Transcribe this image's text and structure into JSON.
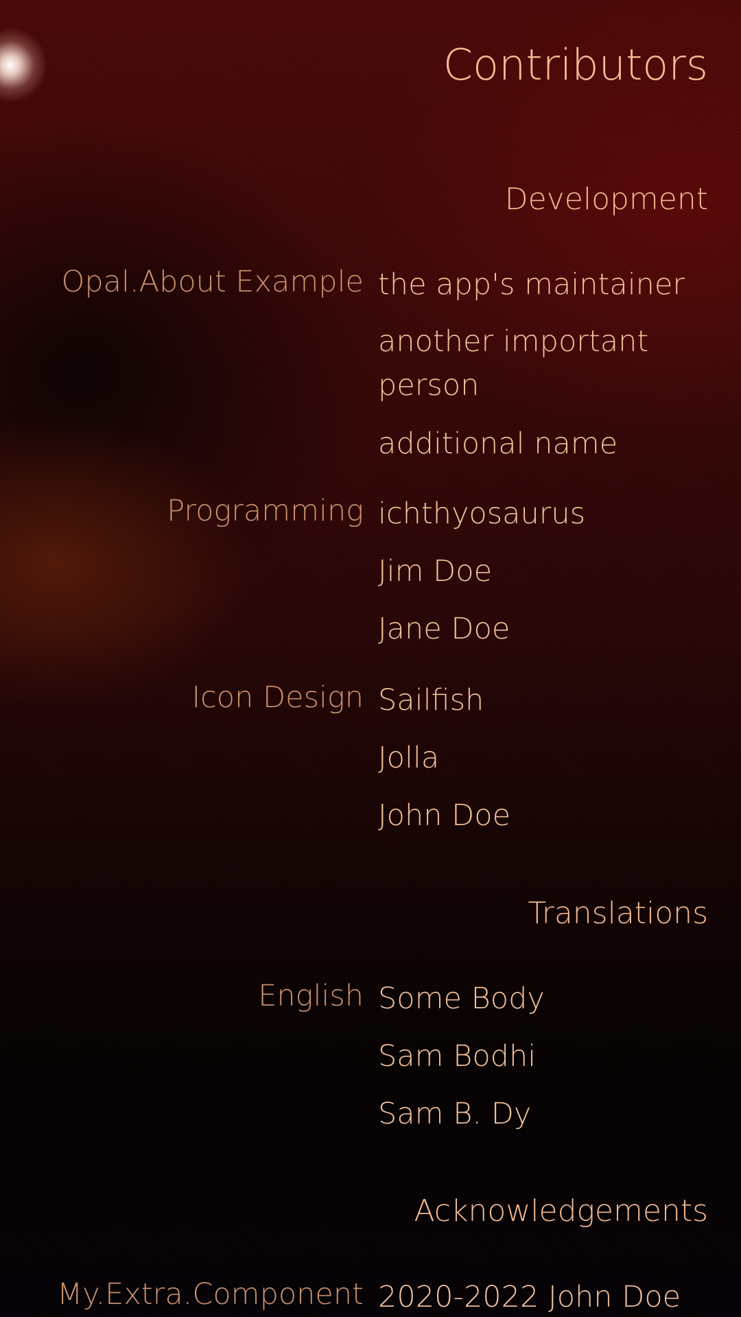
{
  "page": {
    "title": "Contributors"
  },
  "sections": [
    {
      "header": "Development",
      "groups": [
        {
          "label": "Opal.About Example",
          "names": [
            "the app's maintainer",
            "another important person",
            "additional name"
          ]
        },
        {
          "label": "Programming",
          "names": [
            "ichthyosaurus",
            "Jim Doe",
            "Jane Doe"
          ]
        },
        {
          "label": "Icon Design",
          "names": [
            "Sailfish",
            "Jolla",
            "John Doe"
          ]
        }
      ]
    },
    {
      "header": "Translations",
      "groups": [
        {
          "label": "English",
          "names": [
            "Some Body",
            "Sam Bodhi",
            "Sam B. Dy"
          ]
        }
      ]
    },
    {
      "header": "Acknowledgements",
      "groups": [
        {
          "label": "My.Extra.Component",
          "names": [
            "2020-2022 John Doe"
          ]
        }
      ]
    }
  ],
  "colors": {
    "title": "#f3bb94",
    "label": "#c8906d",
    "value": "#f0c09b",
    "background_top": "#4a0808",
    "background_bottom": "#050206"
  }
}
